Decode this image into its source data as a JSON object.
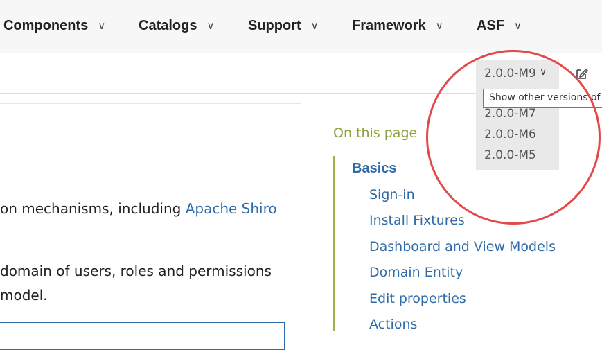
{
  "nav": {
    "items": [
      {
        "label": "Components"
      },
      {
        "label": "Catalogs"
      },
      {
        "label": "Support"
      },
      {
        "label": "Framework"
      },
      {
        "label": "ASF"
      }
    ]
  },
  "version_selector": {
    "selected": "2.0.0-M9",
    "tooltip": "Show other versions of p",
    "options": [
      "2.0.0-M7",
      "2.0.0-M6",
      "2.0.0-M5"
    ]
  },
  "toolbar": {
    "edit_icon": "edit-pencil-icon"
  },
  "content": {
    "line1_text": "on mechanisms, including ",
    "line1_link": "Apache Shiro",
    "line2": "domain of users, roles and permissions",
    "line3": "model."
  },
  "toc": {
    "heading": "On this page",
    "basics": "Basics",
    "links": [
      "Sign-in",
      "Install Fixtures",
      "Dashboard and View Models",
      "Domain Entity",
      "Edit properties",
      "Actions"
    ]
  },
  "colors": {
    "link": "#2f6ba8",
    "toc_accent": "#9bb14a",
    "highlight": "#e24a4a"
  }
}
